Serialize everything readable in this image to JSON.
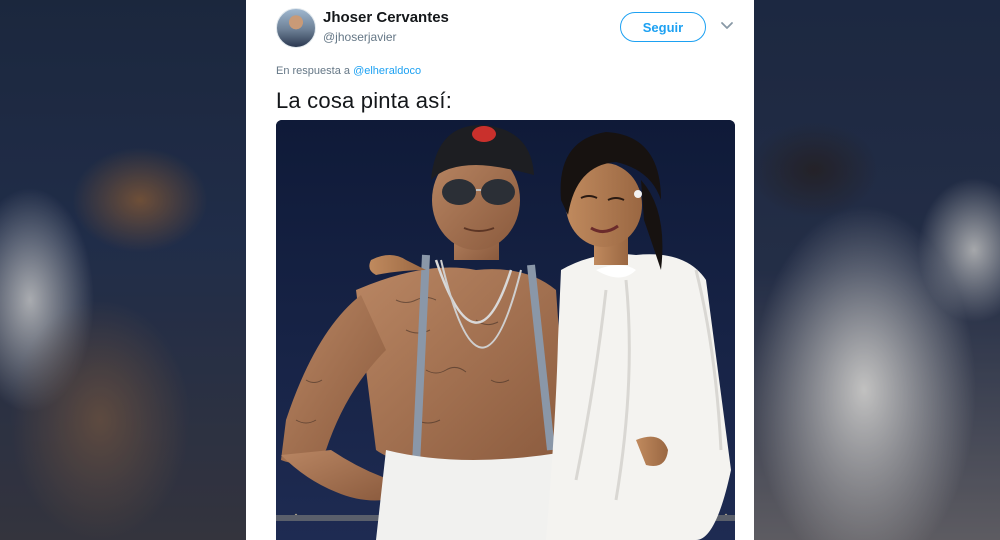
{
  "tweet": {
    "author": {
      "display_name": "Jhoser Cervantes",
      "handle": "@jhoserjavier",
      "avatar": "user-avatar-photo"
    },
    "follow_label": "Seguir",
    "menu_icon": "chevron-down-icon",
    "reply_prefix": "En respuesta a",
    "reply_mention": "@elheraldoco",
    "text": "La cosa pinta así:",
    "media": "photo-couple-on-yacht-at-night"
  },
  "colors": {
    "accent": "#1da1f2",
    "text_primary": "#14171a",
    "text_secondary": "#657786"
  }
}
